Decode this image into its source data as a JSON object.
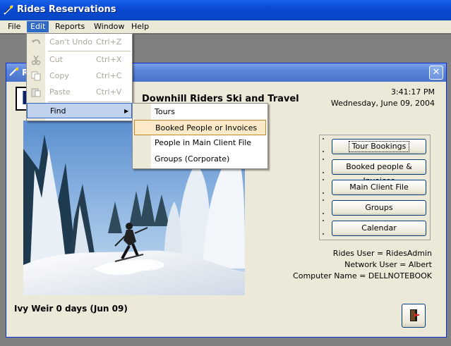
{
  "window": {
    "title": "Rides Reservations"
  },
  "menubar": {
    "file": "File",
    "edit": "Edit",
    "reports": "Reports",
    "window": "Window",
    "help": "Help"
  },
  "edit_menu": {
    "items": [
      {
        "label": "Can't Undo",
        "shortcut": "Ctrl+Z",
        "icon": "undo-icon",
        "enabled": false
      },
      {
        "label": "Cut",
        "shortcut": "Ctrl+X",
        "icon": "cut-icon",
        "enabled": false
      },
      {
        "label": "Copy",
        "shortcut": "Ctrl+C",
        "icon": "copy-icon",
        "enabled": false
      },
      {
        "label": "Paste",
        "shortcut": "Ctrl+V",
        "icon": "paste-icon",
        "enabled": false
      },
      {
        "label": "Find",
        "shortcut": "",
        "icon": "",
        "enabled": true
      }
    ]
  },
  "find_submenu": {
    "items": [
      "Tours",
      "Booked People or Invoices",
      "People in Main Client File",
      "Groups (Corporate)"
    ],
    "highlighted": "Booked People or Invoices"
  },
  "child_window": {
    "title": "R",
    "logo_text": "R",
    "company": "Downhill Riders Ski and Travel",
    "time": "3:41:17 PM",
    "date": "Wednesday, June 09, 2004"
  },
  "buttons": {
    "tour_bookings": "Tour Bookings",
    "booked_people": "Booked people & Invoices",
    "main_client": "Main Client File",
    "groups": "Groups",
    "calendar": "Calendar"
  },
  "info": {
    "rides_user": "Rides User = RidesAdmin",
    "network_user": "Network User = Albert",
    "computer_name": "Computer Name = DELLNOTEBOOK"
  },
  "status": {
    "left": "Ivy Weir 0 days (Jun 09)"
  },
  "colors": {
    "titlebar": "#0a49d4",
    "menu_highlight": "#316ac5",
    "face": "#ece9d8",
    "hover_orange": "#fbe9c7"
  }
}
